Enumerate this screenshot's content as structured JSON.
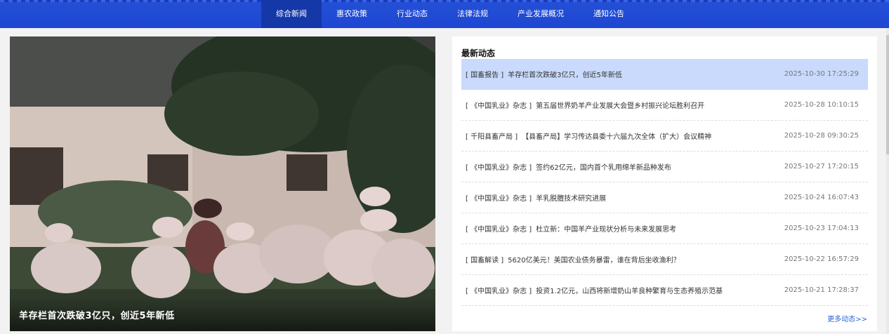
{
  "nav": {
    "items": [
      {
        "label": "综合新闻",
        "active": true
      },
      {
        "label": "惠农政策",
        "active": false
      },
      {
        "label": "行业动态",
        "active": false
      },
      {
        "label": "法律法规",
        "active": false
      },
      {
        "label": "产业发展概况",
        "active": false
      },
      {
        "label": "通知公告",
        "active": false
      }
    ]
  },
  "hero": {
    "caption": "羊存栏首次跌破3亿只，创近5年新低"
  },
  "news": {
    "title": "最新动态",
    "more_label": "更多动态>>",
    "items": [
      {
        "source": "[ 国畜报告 ]",
        "title": "羊存栏首次跌破3亿只，创近5年新低",
        "date": "2025-10-30 17:25:29"
      },
      {
        "source": "[ 《中国乳业》杂志 ]",
        "title": "第五届世界奶羊产业发展大会暨乡村振兴论坛胜利召开",
        "date": "2025-10-28 10:10:15"
      },
      {
        "source": "[ 千阳县畜产局 ]",
        "title": "【县畜产局】学习传达县委十六届九次全体（扩大）会议精神",
        "date": "2025-10-28 09:30:25"
      },
      {
        "source": "[ 《中国乳业》杂志 ]",
        "title": "签约62亿元，国内首个乳用绵羊新品种发布",
        "date": "2025-10-27 17:20:15"
      },
      {
        "source": "[ 《中国乳业》杂志 ]",
        "title": "羊乳脱膻技术研究进展",
        "date": "2025-10-24 16:07:43"
      },
      {
        "source": "[ 《中国乳业》杂志 ]",
        "title": "杜立新：中国羊产业现状分析与未来发展思考",
        "date": "2025-10-23 17:04:13"
      },
      {
        "source": "[ 国畜解读 ]",
        "title": "5620亿美元！美国农业债务暴雷，谁在背后坐收渔利？",
        "date": "2025-10-22 16:57:29"
      },
      {
        "source": "[ 《中国乳业》杂志 ]",
        "title": "投资1.2亿元，山西将新增奶山羊良种繁育与生态养殖示范基",
        "date": "2025-10-21 17:28:37"
      }
    ]
  },
  "colors": {
    "nav_bg": "#1d47d2",
    "nav_active": "#1538a8",
    "highlight": "#c9dafc",
    "link": "#2a63d8"
  }
}
